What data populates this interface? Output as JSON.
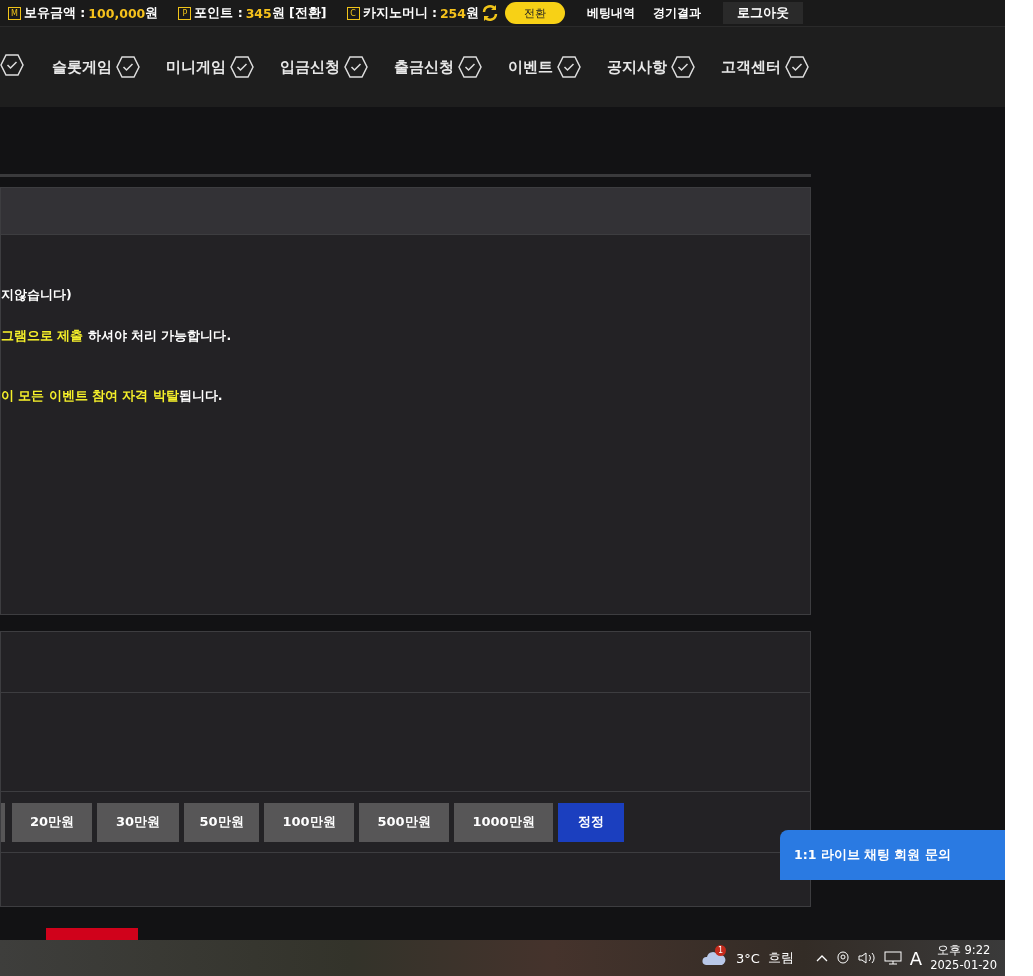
{
  "top_bar": {
    "balances": [
      {
        "icon": "M",
        "label": "보유금액 :",
        "value": "100,000",
        "unit": "원"
      },
      {
        "icon": "P",
        "label": "포인트 :",
        "value": "345",
        "unit": "원 [전환]"
      },
      {
        "icon": "C",
        "label": "카지노머니 :",
        "value": "254",
        "unit": "원"
      }
    ],
    "convert_button": "전환",
    "links": [
      "베팅내역",
      "경기결과"
    ],
    "logout_button": "로그아웃"
  },
  "nav": {
    "items": [
      "슬롯게임",
      "미니게임",
      "입금신청",
      "출금신청",
      "이벤트",
      "공지사항",
      "고객센터"
    ]
  },
  "notice_lines": [
    [
      {
        "text": "지않습니다)",
        "highlight": false
      }
    ],
    [
      {
        "text": "그램으로 제출",
        "highlight": true
      },
      {
        "text": " 하셔야 처리 가능합니다.",
        "highlight": false
      }
    ],
    [
      {
        "text": "이 모든 이벤트 참여 자격 박탈",
        "highlight": true
      },
      {
        "text": "됩니다.",
        "highlight": false
      }
    ]
  ],
  "amount_buttons": [
    {
      "label": "20만원",
      "kind": "amount"
    },
    {
      "label": "30만원",
      "kind": "amount"
    },
    {
      "label": "50만원",
      "kind": "amount"
    },
    {
      "label": "100만원",
      "kind": "amount"
    },
    {
      "label": "500만원",
      "kind": "amount"
    },
    {
      "label": "1000만원",
      "kind": "amount"
    },
    {
      "label": "정정",
      "kind": "reset"
    }
  ],
  "chat_button": "1:1 라이브 채팅 회원 문의",
  "taskbar": {
    "weather_badge": "1",
    "temperature": "3°C",
    "weather": "흐림",
    "ime": "A",
    "time": "오후 9:22",
    "date": "2025-01-20"
  }
}
